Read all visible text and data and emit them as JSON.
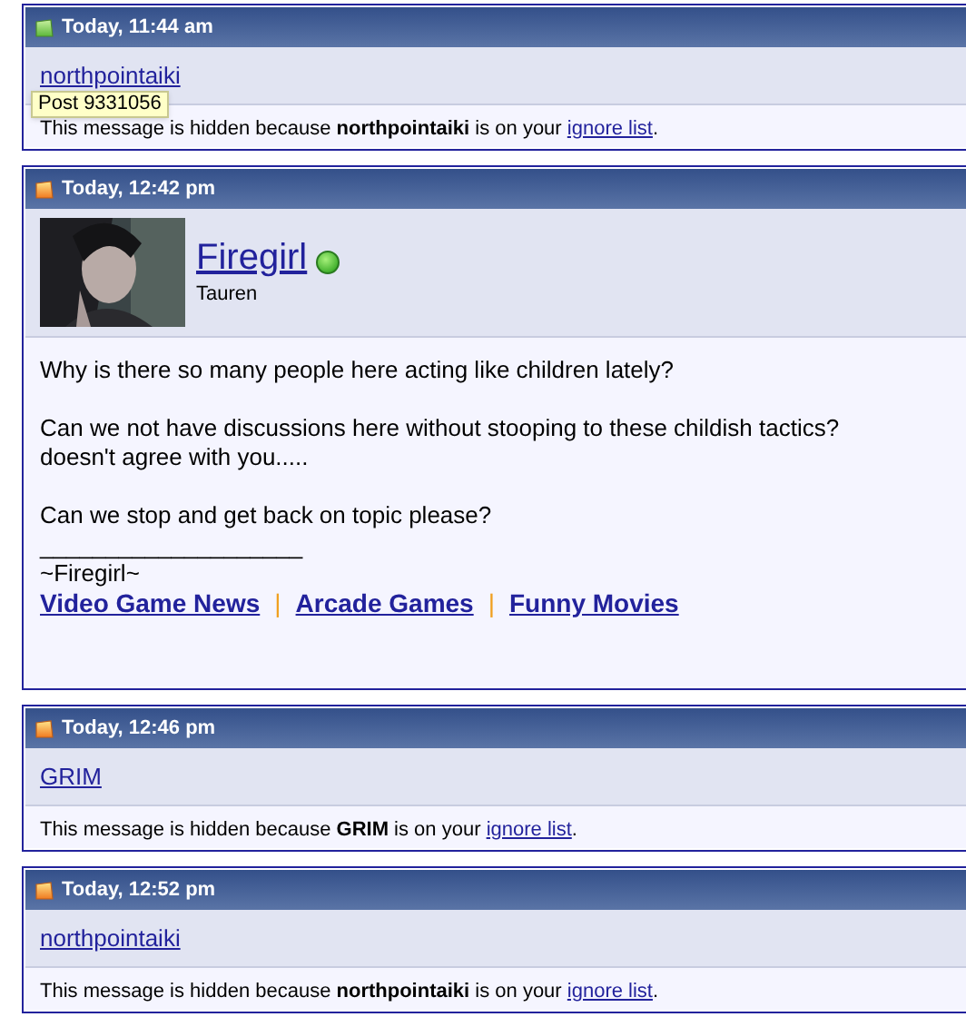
{
  "tooltip": "Post 9331056",
  "posts": [
    {
      "kind": "hidden",
      "new": false,
      "time": "Today, 11:44 am",
      "user": "northpointaiki",
      "notice": "This message is hidden because **northpointaiki** is on your ",
      "notice_link": "ignore list",
      "notice_end": "."
    },
    {
      "kind": "full",
      "new": true,
      "time": "Today, 12:42 pm",
      "user": "Firegirl",
      "online": true,
      "rank": "Tauren",
      "avatar": {
        "kind": "picture"
      },
      "paragraphs": [
        [
          "Why is there so many people here acting like children lately?"
        ],
        [
          "Can we not have discussions here without stooping to these childish tactics?",
          "doesn't agree with you....."
        ],
        [
          "Can we stop and get back on topic please?"
        ]
      ],
      "signature_rule": "____________________",
      "signature": "~Firegirl~",
      "separator": "|",
      "links": [
        "Video Game News",
        "Arcade Games",
        "Funny Movies"
      ]
    },
    {
      "kind": "hidden",
      "new": true,
      "time": "Today, 12:46 pm",
      "user": "GRIM",
      "notice": "This message is hidden because **GRIM** is on your ",
      "notice_link": "ignore list",
      "notice_end": "."
    },
    {
      "kind": "hidden",
      "new": true,
      "time": "Today, 12:52 pm",
      "user": "northpointaiki",
      "notice": "This message is hidden because **northpointaiki** is on your ",
      "notice_link": "ignore list",
      "notice_end": "."
    }
  ]
}
